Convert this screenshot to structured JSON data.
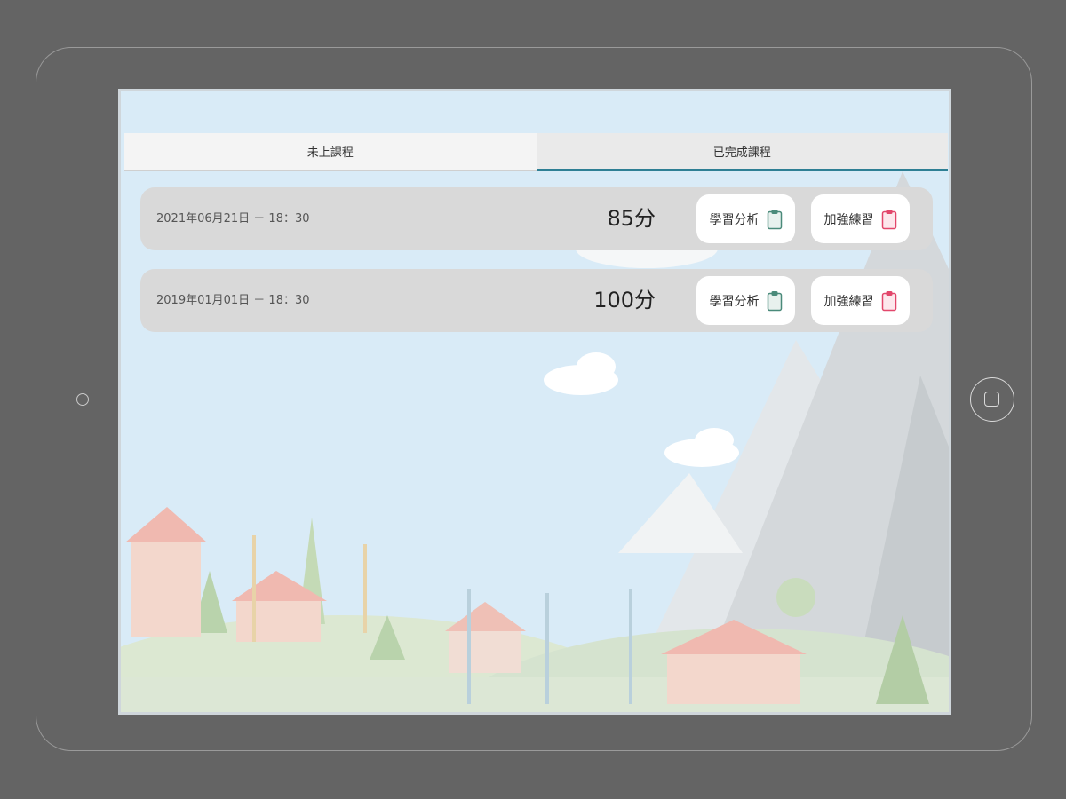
{
  "tabs": {
    "upcoming_label": "未上課程",
    "completed_label": "已完成課程"
  },
  "sessions": [
    {
      "datetime": "2021年06月21日 － 18：30",
      "score": "85分",
      "analysis_label": "學習分析",
      "practice_label": "加強練習"
    },
    {
      "datetime": "2019年01月01日 － 18：30",
      "score": "100分",
      "analysis_label": "學習分析",
      "practice_label": "加強練習"
    }
  ],
  "colors": {
    "device_background": "#646464",
    "active_tab_underline": "#2e7f94",
    "row_background": "#d9d9d9",
    "analysis_icon": "#4a8a7a",
    "practice_icon": "#e2476b"
  },
  "icons": {
    "analysis": "clipboard-icon",
    "practice": "clipboard-icon"
  }
}
